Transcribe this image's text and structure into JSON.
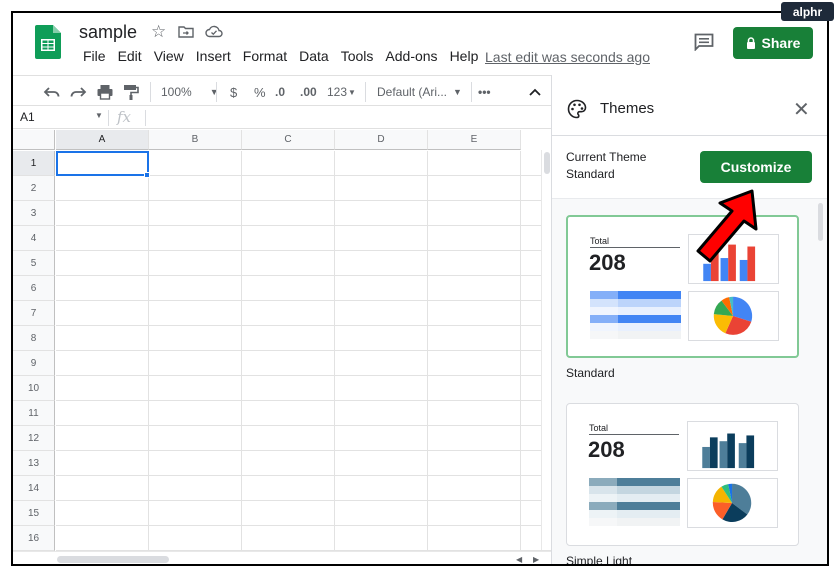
{
  "header": {
    "doc_title": "sample",
    "menu": [
      "File",
      "Edit",
      "View",
      "Insert",
      "Format",
      "Data",
      "Tools",
      "Add-ons",
      "Help"
    ],
    "last_edit": "Last edit was seconds ago",
    "share_label": "Share",
    "icons": [
      "sheets-logo",
      "star-icon",
      "move-icon",
      "cloud-icon",
      "comment-icon",
      "lock-icon"
    ]
  },
  "toolbar": {
    "zoom": "100%",
    "currency": "$",
    "percent": "%",
    "decrease_decimal": ".0",
    "increase_decimal": ".00",
    "more_formats": "123",
    "font": "Default (Ari...",
    "more": "•••"
  },
  "formula_bar": {
    "cell_ref": "A1",
    "fx": "fx"
  },
  "grid": {
    "columns": [
      "A",
      "B",
      "C",
      "D",
      "E"
    ],
    "rows": [
      "1",
      "2",
      "3",
      "4",
      "5",
      "6",
      "7",
      "8",
      "9",
      "10",
      "11",
      "12",
      "13",
      "14",
      "15",
      "16"
    ],
    "selected_cell": "A1"
  },
  "themes_panel": {
    "title": "Themes",
    "current_theme_label": "Current Theme",
    "current_theme_value": "Standard",
    "customize_label": "Customize",
    "themes": [
      {
        "name": "Standard",
        "total_label": "Total",
        "total_value": "208",
        "bar_colors": [
          "#4285f4",
          "#ea4335",
          "#4285f4",
          "#ea4335",
          "#4285f4",
          "#ea4335"
        ],
        "pie_colors": [
          "#4285f4",
          "#ea4335",
          "#fbbc04",
          "#34a853",
          "#ff6d01",
          "#46bdc6"
        ]
      },
      {
        "name": "Simple Light",
        "total_label": "Total",
        "total_value": "208",
        "bar_colors": [
          "#2c5f7c",
          "#0b3d5c",
          "#2c5f7c",
          "#0b3d5c",
          "#2c5f7c",
          "#0b3d5c"
        ],
        "pie_colors": [
          "#4e7e99",
          "#0b3d5c",
          "#fb5e28",
          "#f4b400",
          "#2dbf80",
          "#1a73e8"
        ]
      }
    ]
  },
  "brand": {
    "logo_text": "alphr"
  },
  "colors": {
    "accent_green": "#188038",
    "selection_blue": "#1a73e8",
    "arrow_red": "#ff0000"
  }
}
